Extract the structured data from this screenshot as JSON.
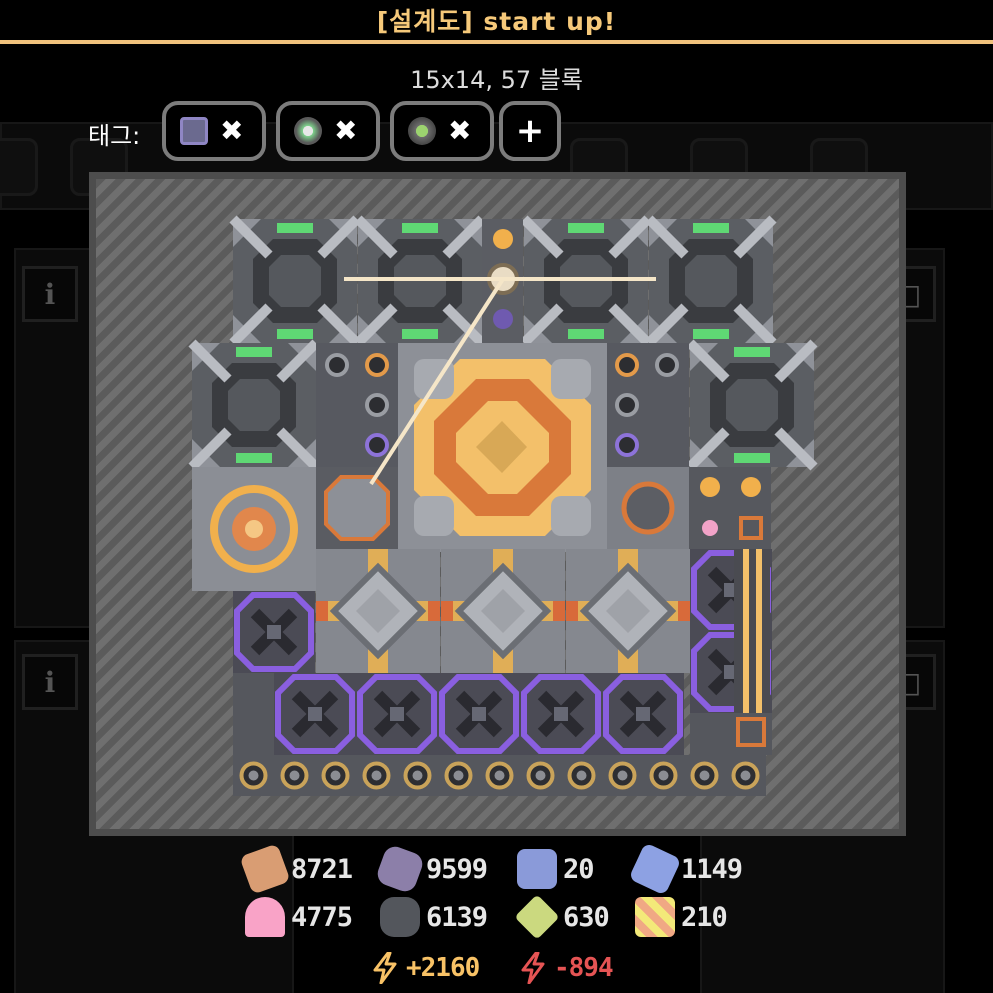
{
  "header": {
    "title": "[설계도] start up!",
    "size_info": "15x14, 57 블록"
  },
  "tags": {
    "label": "태그:",
    "items": [
      {
        "icon": "plastanium-icon",
        "remove": "✖"
      },
      {
        "icon": "unit-icon",
        "remove": "✖"
      },
      {
        "icon": "bug-unit-icon",
        "remove": "✖"
      },
      {
        "icon": "unit-icon-2",
        "remove": "✖"
      }
    ],
    "add": "+"
  },
  "background": {
    "info_label": "i"
  },
  "requirements": [
    {
      "icon": "copper-icon",
      "color": "#d99d73",
      "value": "8721"
    },
    {
      "icon": "lead-icon",
      "color": "#8c7fa9",
      "value": "9599"
    },
    {
      "icon": "metaglass-icon",
      "color": "#8a9ad9",
      "value": "20"
    },
    {
      "icon": "titanium-icon",
      "color": "#8da1e3",
      "value": "1149"
    },
    {
      "icon": "thorium-icon",
      "color": "#f9a3c7",
      "value": "4775"
    },
    {
      "icon": "silicon-icon",
      "color": "#53565c",
      "value": "6139"
    },
    {
      "icon": "plastanium-icon",
      "color": "#cbd97f",
      "value": "630"
    },
    {
      "icon": "surge-alloy-icon",
      "color": "#f3e979",
      "value": "210"
    }
  ],
  "power": {
    "produced": "+2160",
    "produced_color": "#f8c266",
    "consumed": "-894",
    "consumed_color": "#e55454"
  }
}
